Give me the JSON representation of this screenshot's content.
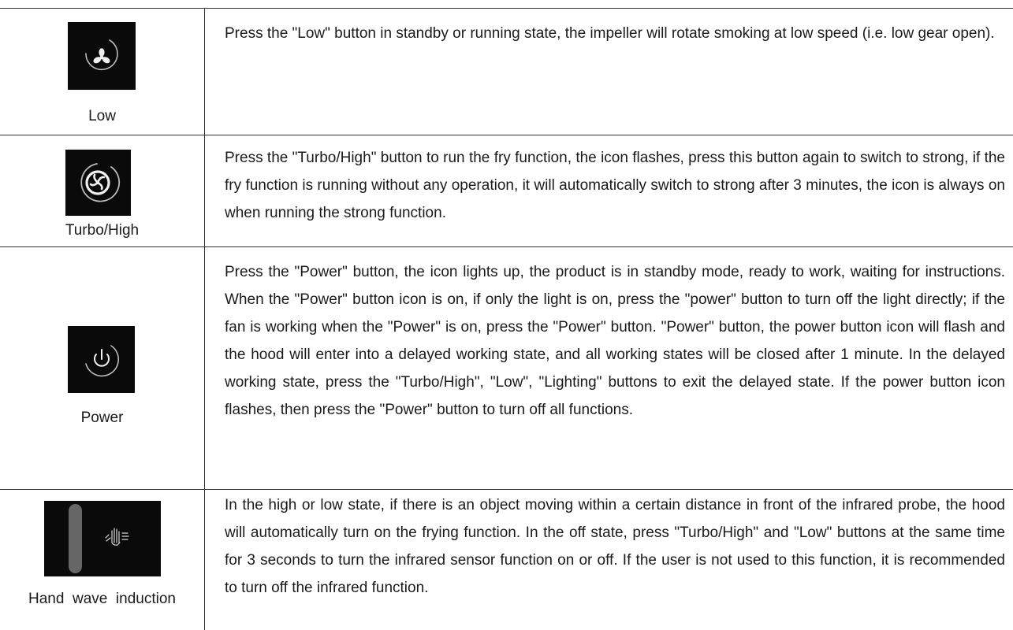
{
  "rows": [
    {
      "label": "Low",
      "icon": "fan-icon",
      "text": "Press the \"Low\" button in standby or running state, the impeller will rotate smoking at low speed (i.e. low gear open)."
    },
    {
      "label": "Turbo/High",
      "icon": "turbo-swirl-icon",
      "text": "Press the \"Turbo/High\" button to run the fry function, the icon flashes, press this button again to switch to strong, if the fry function is running without any operation, it will automatically switch to strong after 3 minutes, the icon is always on when running the strong function."
    },
    {
      "label": "Power",
      "icon": "power-icon",
      "text": "Press the \"Power\" button, the icon lights up, the product is in standby mode, ready to work, waiting for instructions. When the \"Power\" button icon is on, if only the light is on, press the \"power\" button to turn off the light directly; if the fan is working when the \"Power\" is on, press the \"Power\" button. \"Power\" button, the power button icon will flash and the hood will enter into a delayed working state, and all working states will be closed after 1 minute. In the delayed working state, press the \"Turbo/High\", \"Low\", \"Lighting\" buttons to exit the delayed state. If the power button icon flashes, then press the \"Power\" button to turn off all functions."
    },
    {
      "label": "Hand  wave  induction",
      "icon": "hand-wave-icon",
      "text": "In the high or low state, if there is an object moving within a certain distance in front of the infrared probe, the hood will automatically turn on the frying function. In the off state, press \"Turbo/High\" and \"Low\" buttons at the same time for 3 seconds to turn the infrared sensor function on or off. If the user is not used to this function, it is recommended to turn off the infrared function."
    }
  ]
}
